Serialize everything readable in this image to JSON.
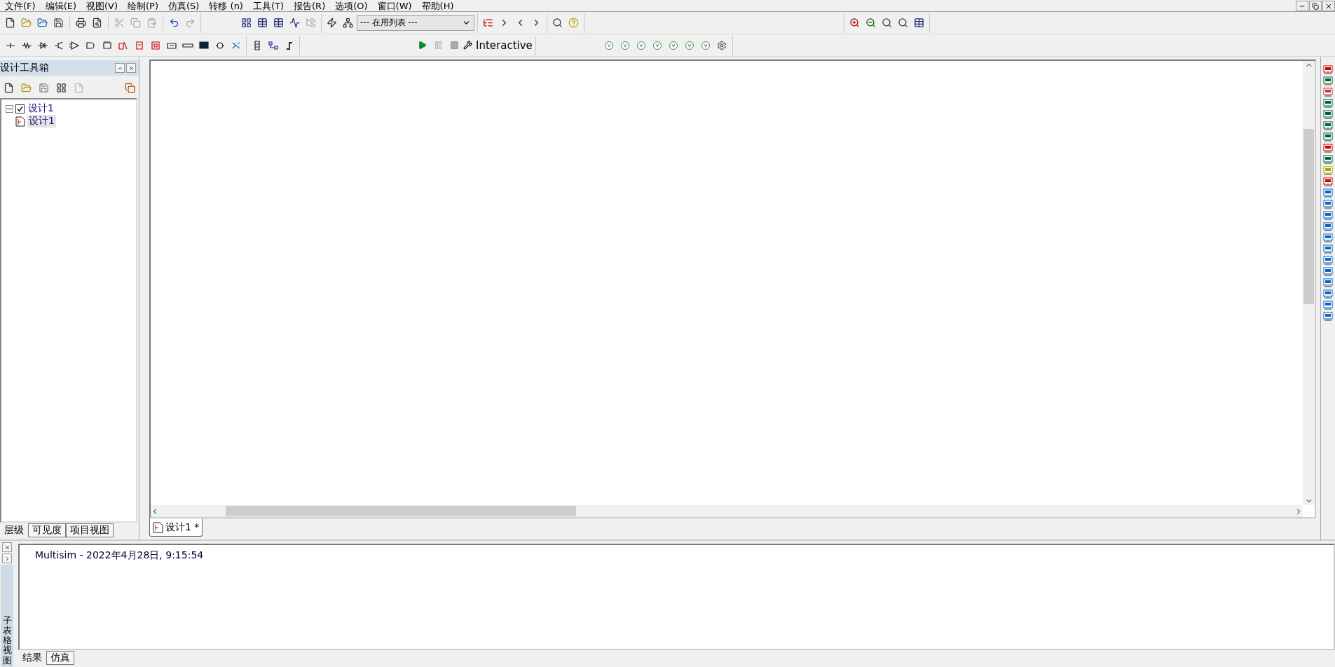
{
  "menu": [
    {
      "label": "文件(F)"
    },
    {
      "label": "编辑(E)"
    },
    {
      "label": "视图(V)"
    },
    {
      "label": "绘制(P)"
    },
    {
      "label": "仿真(S)"
    },
    {
      "label": "转移 (n)"
    },
    {
      "label": "工具(T)"
    },
    {
      "label": "报告(R)"
    },
    {
      "label": "选项(O)"
    },
    {
      "label": "窗口(W)"
    },
    {
      "label": "帮助(H)"
    }
  ],
  "toolbar": {
    "in_use_list": {
      "value": "--- 在用列表 ---"
    },
    "sim_mode": "Interactive"
  },
  "design_toolbox": {
    "title": "设计工具箱",
    "tree": [
      {
        "label": "设计1",
        "checked": true,
        "expanded": true,
        "selected": false,
        "children": [
          {
            "label": "设计1",
            "selected": true
          }
        ]
      }
    ],
    "tabs": [
      {
        "label": "层级",
        "selected": true
      },
      {
        "label": "可见度",
        "selected": false
      },
      {
        "label": "项目视图",
        "selected": false
      }
    ]
  },
  "document_tabs": [
    {
      "label": "设计1 *",
      "selected": true
    }
  ],
  "output": {
    "side_label": "子表格视图",
    "lines": [
      "Multisim  -  2022年4月28日, 9:15:54"
    ],
    "tabs": [
      {
        "label": "结果",
        "selected": true
      },
      {
        "label": "仿真",
        "selected": false
      }
    ]
  }
}
